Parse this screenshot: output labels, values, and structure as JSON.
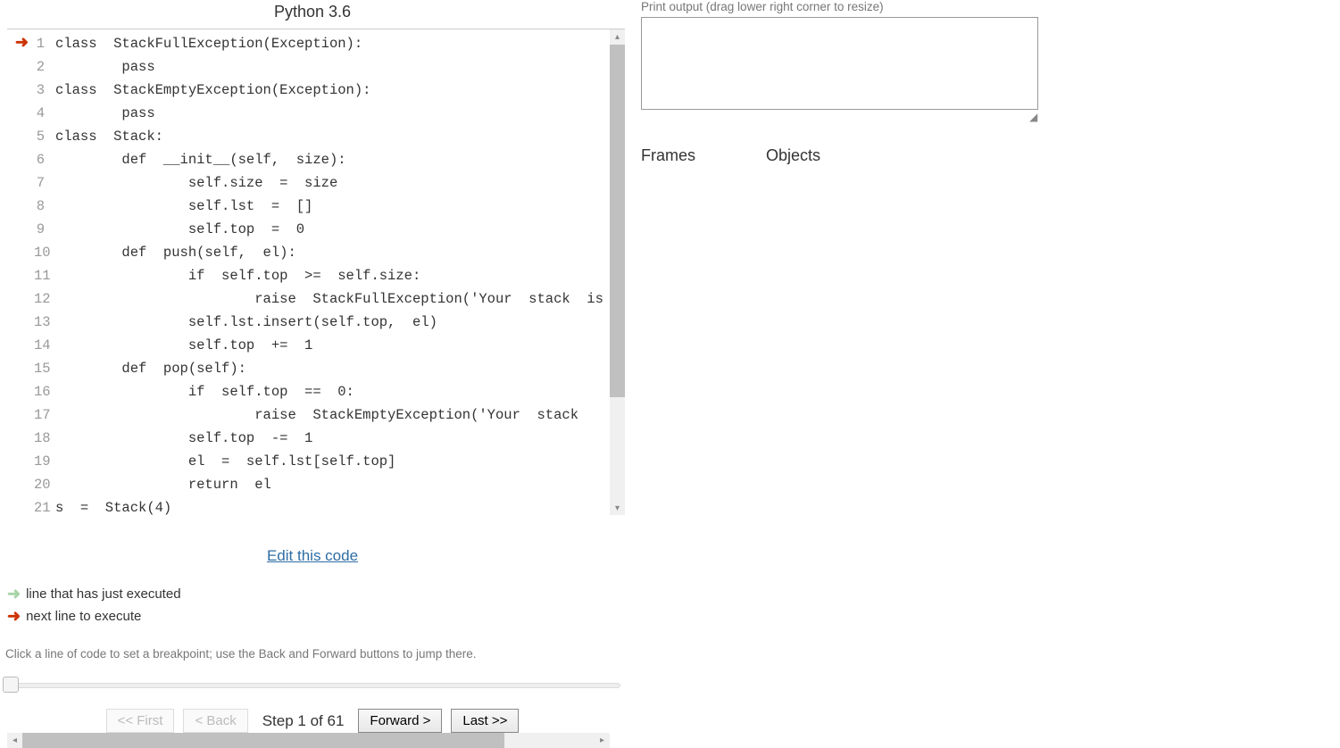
{
  "lang_title": "Python 3.6",
  "current_line_arrow_at": 1,
  "code": [
    {
      "n": 1,
      "text": "class  StackFullException(Exception):"
    },
    {
      "n": 2,
      "text": "        pass"
    },
    {
      "n": 3,
      "text": "class  StackEmptyException(Exception):"
    },
    {
      "n": 4,
      "text": "        pass"
    },
    {
      "n": 5,
      "text": "class  Stack:"
    },
    {
      "n": 6,
      "text": "        def  __init__(self,  size):"
    },
    {
      "n": 7,
      "text": "                self.size  =  size"
    },
    {
      "n": 8,
      "text": "                self.lst  =  []"
    },
    {
      "n": 9,
      "text": "                self.top  =  0"
    },
    {
      "n": 10,
      "text": "        def  push(self,  el):"
    },
    {
      "n": 11,
      "text": "                if  self.top  >=  self.size:"
    },
    {
      "n": 12,
      "text": "                        raise  StackFullException('Your  stack  is"
    },
    {
      "n": 13,
      "text": "                self.lst.insert(self.top,  el)"
    },
    {
      "n": 14,
      "text": "                self.top  +=  1"
    },
    {
      "n": 15,
      "text": "        def  pop(self):"
    },
    {
      "n": 16,
      "text": "                if  self.top  ==  0:"
    },
    {
      "n": 17,
      "text": "                        raise  StackEmptyException('Your  stack  "
    },
    {
      "n": 18,
      "text": "                self.top  -=  1"
    },
    {
      "n": 19,
      "text": "                el  =  self.lst[self.top]"
    },
    {
      "n": 20,
      "text": "                return  el"
    },
    {
      "n": 21,
      "text": "s  =  Stack(4)"
    }
  ],
  "edit_link": "Edit this code",
  "legend_executed": "line that has just executed",
  "legend_next": "next line to execute",
  "hint": "Click a line of code to set a breakpoint; use the Back and Forward buttons to jump there.",
  "step_current": 1,
  "step_total": 61,
  "step_label": "Step 1 of 61",
  "buttons": {
    "first": "<< First",
    "back": "< Back",
    "forward": "Forward >",
    "last": "Last >>"
  },
  "output_label": "Print output (drag lower right corner to resize)",
  "frames_label": "Frames",
  "objects_label": "Objects"
}
